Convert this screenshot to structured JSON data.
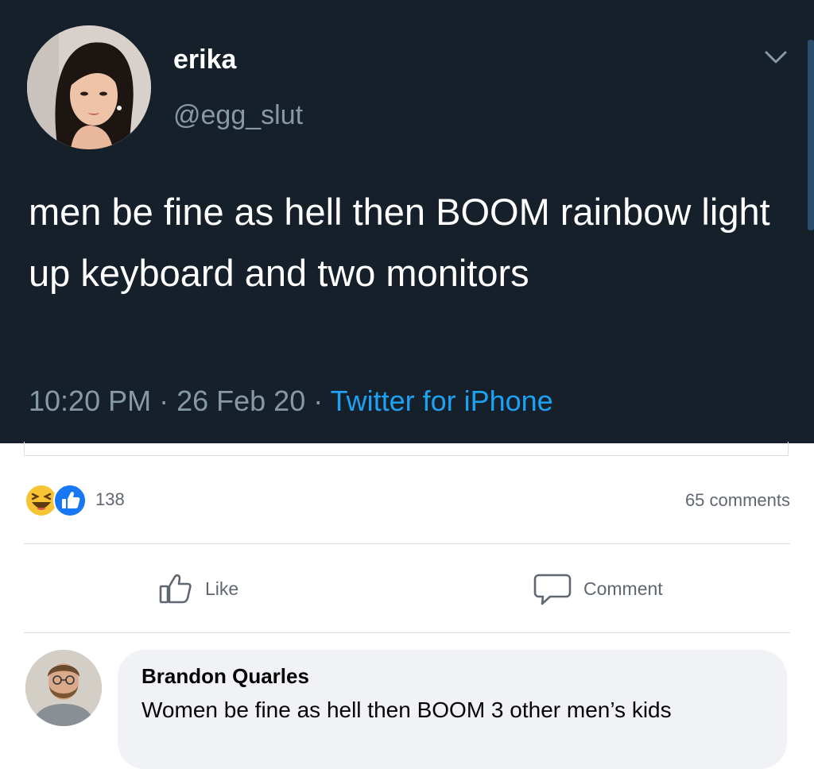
{
  "tweet": {
    "display_name": "erika",
    "handle": "@egg_slut",
    "text": "men be fine as hell then BOOM rainbow light up keyboard and two monitors",
    "time": "10:20 PM",
    "date": "26 Feb 20",
    "source": "Twitter for iPhone",
    "separator": " · ",
    "avatar": "avatar-photo",
    "menu_icon": "chevron-down-icon"
  },
  "post": {
    "reaction_icons": [
      "haha-reaction-icon",
      "like-reaction-icon"
    ],
    "reaction_count": "138",
    "comment_count": "65 comments",
    "actions": {
      "like_label": "Like",
      "comment_label": "Comment"
    }
  },
  "comment": {
    "author": "Brandon Quarles",
    "text": "Women be fine as hell then BOOM 3 other men’s kids",
    "avatar": "avatar-photo"
  },
  "colors": {
    "tweet_bg": "#15202b",
    "tweet_secondary": "#8899a6",
    "twitter_blue": "#1da1f2",
    "fb_like_blue": "#1877f2",
    "fb_text_secondary": "#606770",
    "bubble_bg": "#f0f2f5"
  }
}
